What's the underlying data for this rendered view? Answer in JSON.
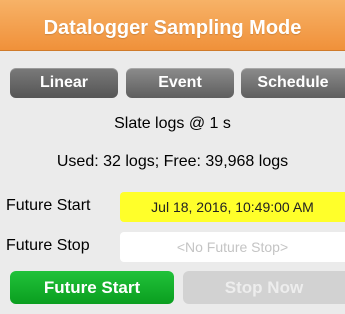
{
  "header": {
    "title": "Datalogger Sampling Mode",
    "accent": "#f0913a"
  },
  "mode_tabs": [
    {
      "label": "Linear",
      "selected": true
    },
    {
      "label": "Event",
      "selected": false
    },
    {
      "label": "Schedule",
      "selected": false
    }
  ],
  "status": {
    "rate": "Slate logs @ 1 s",
    "usage": "Used: 32 logs; Free: 39,968 logs"
  },
  "future_start": {
    "label": "Future Start",
    "value": "Jul 18, 2016, 10:49:00 AM",
    "highlight": "#ffff2a"
  },
  "future_stop": {
    "label": "Future Stop",
    "placeholder": "<No Future Stop>"
  },
  "actions": {
    "future_start_label": "Future Start",
    "future_start_color": "#0a9e1f",
    "stop_now_label": "Stop Now",
    "stop_now_enabled": false
  }
}
